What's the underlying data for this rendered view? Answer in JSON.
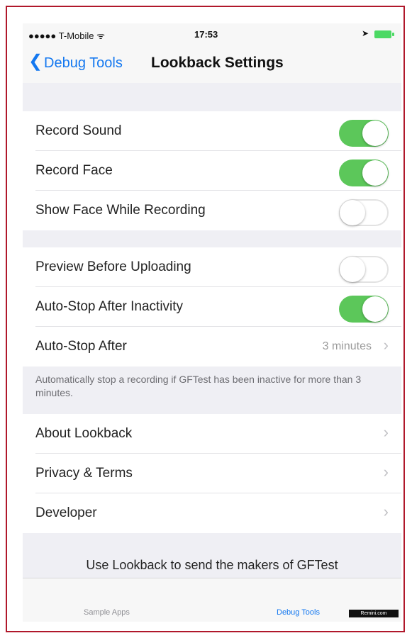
{
  "status_bar": {
    "carrier": "●●●●● T-Mobile ᯤ",
    "time": "17:53",
    "location_glyph": "➤"
  },
  "nav": {
    "back_chevron": "❮",
    "back_label": "Debug Tools",
    "title": "Lookback Settings"
  },
  "group1": [
    {
      "label": "Record Sound",
      "on": true
    },
    {
      "label": "Record Face",
      "on": true
    },
    {
      "label": "Show Face While Recording",
      "on": false
    }
  ],
  "group2": {
    "preview": {
      "label": "Preview Before Uploading",
      "on": false
    },
    "auto_stop_inactivity": {
      "label": "Auto-Stop After Inactivity",
      "on": true
    },
    "auto_stop_after": {
      "label": "Auto-Stop After",
      "value": "3 minutes"
    },
    "footnote": "Automatically stop a recording if GFTest has been inactive for more than 3 minutes."
  },
  "group3": [
    {
      "label": "About Lookback"
    },
    {
      "label": "Privacy & Terms"
    },
    {
      "label": "Developer"
    }
  ],
  "chevron_glyph": "›",
  "promo_text": "Use Lookback to send the makers of GFTest",
  "tab_bar": {
    "sample_apps": "Sample Apps",
    "debug_tools": "Debug Tools"
  },
  "watermark": "Remini.com",
  "colors": {
    "accent": "#1478f0",
    "toggle_on": "#5cc75a",
    "frame_border": "#b0182b",
    "background": "#efeff4"
  }
}
